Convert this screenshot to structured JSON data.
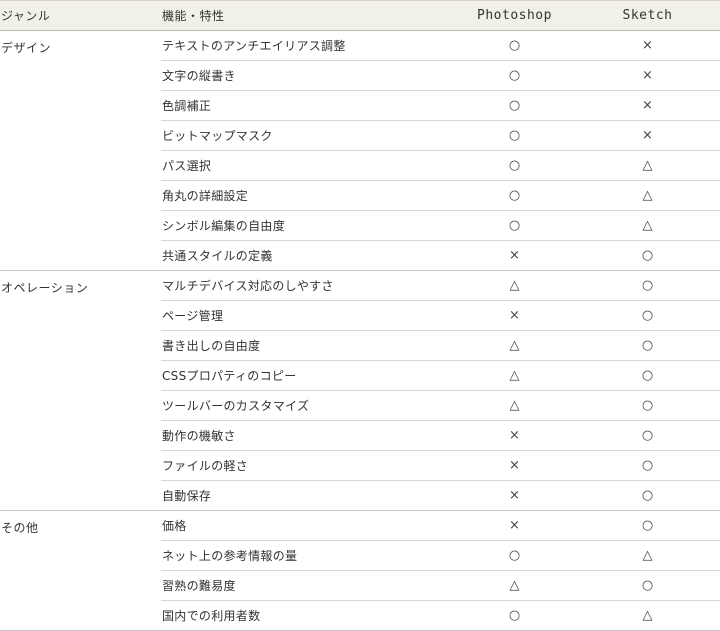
{
  "columns": {
    "genre": "ジャンル",
    "feature": "機能・特性",
    "photoshop": "Photoshop",
    "sketch": "Sketch"
  },
  "groups": [
    {
      "genre": "デザイン",
      "rows": [
        {
          "feature": "テキストのアンチエイリアス調整",
          "photoshop": "○",
          "sketch": "×"
        },
        {
          "feature": "文字の縦書き",
          "photoshop": "○",
          "sketch": "×"
        },
        {
          "feature": "色調補正",
          "photoshop": "○",
          "sketch": "×"
        },
        {
          "feature": "ビットマップマスク",
          "photoshop": "○",
          "sketch": "×"
        },
        {
          "feature": "パス選択",
          "photoshop": "○",
          "sketch": "△"
        },
        {
          "feature": "角丸の詳細設定",
          "photoshop": "○",
          "sketch": "△"
        },
        {
          "feature": "シンボル編集の自由度",
          "photoshop": "○",
          "sketch": "△"
        },
        {
          "feature": "共通スタイルの定義",
          "photoshop": "×",
          "sketch": "○"
        }
      ]
    },
    {
      "genre": "オペレーション",
      "rows": [
        {
          "feature": "マルチデバイス対応のしやすさ",
          "photoshop": "△",
          "sketch": "○"
        },
        {
          "feature": "ページ管理",
          "photoshop": "×",
          "sketch": "○"
        },
        {
          "feature": "書き出しの自由度",
          "photoshop": "△",
          "sketch": "○"
        },
        {
          "feature": "CSSプロパティのコピー",
          "photoshop": "△",
          "sketch": "○"
        },
        {
          "feature": "ツールバーのカスタマイズ",
          "photoshop": "△",
          "sketch": "○"
        },
        {
          "feature": "動作の機敏さ",
          "photoshop": "×",
          "sketch": "○"
        },
        {
          "feature": "ファイルの軽さ",
          "photoshop": "×",
          "sketch": "○"
        },
        {
          "feature": "自動保存",
          "photoshop": "×",
          "sketch": "○"
        }
      ]
    },
    {
      "genre": "その他",
      "rows": [
        {
          "feature": "価格",
          "photoshop": "×",
          "sketch": "○"
        },
        {
          "feature": "ネット上の参考情報の量",
          "photoshop": "○",
          "sketch": "△"
        },
        {
          "feature": "習熟の難易度",
          "photoshop": "△",
          "sketch": "○"
        },
        {
          "feature": "国内での利用者数",
          "photoshop": "○",
          "sketch": "△"
        }
      ]
    }
  ]
}
